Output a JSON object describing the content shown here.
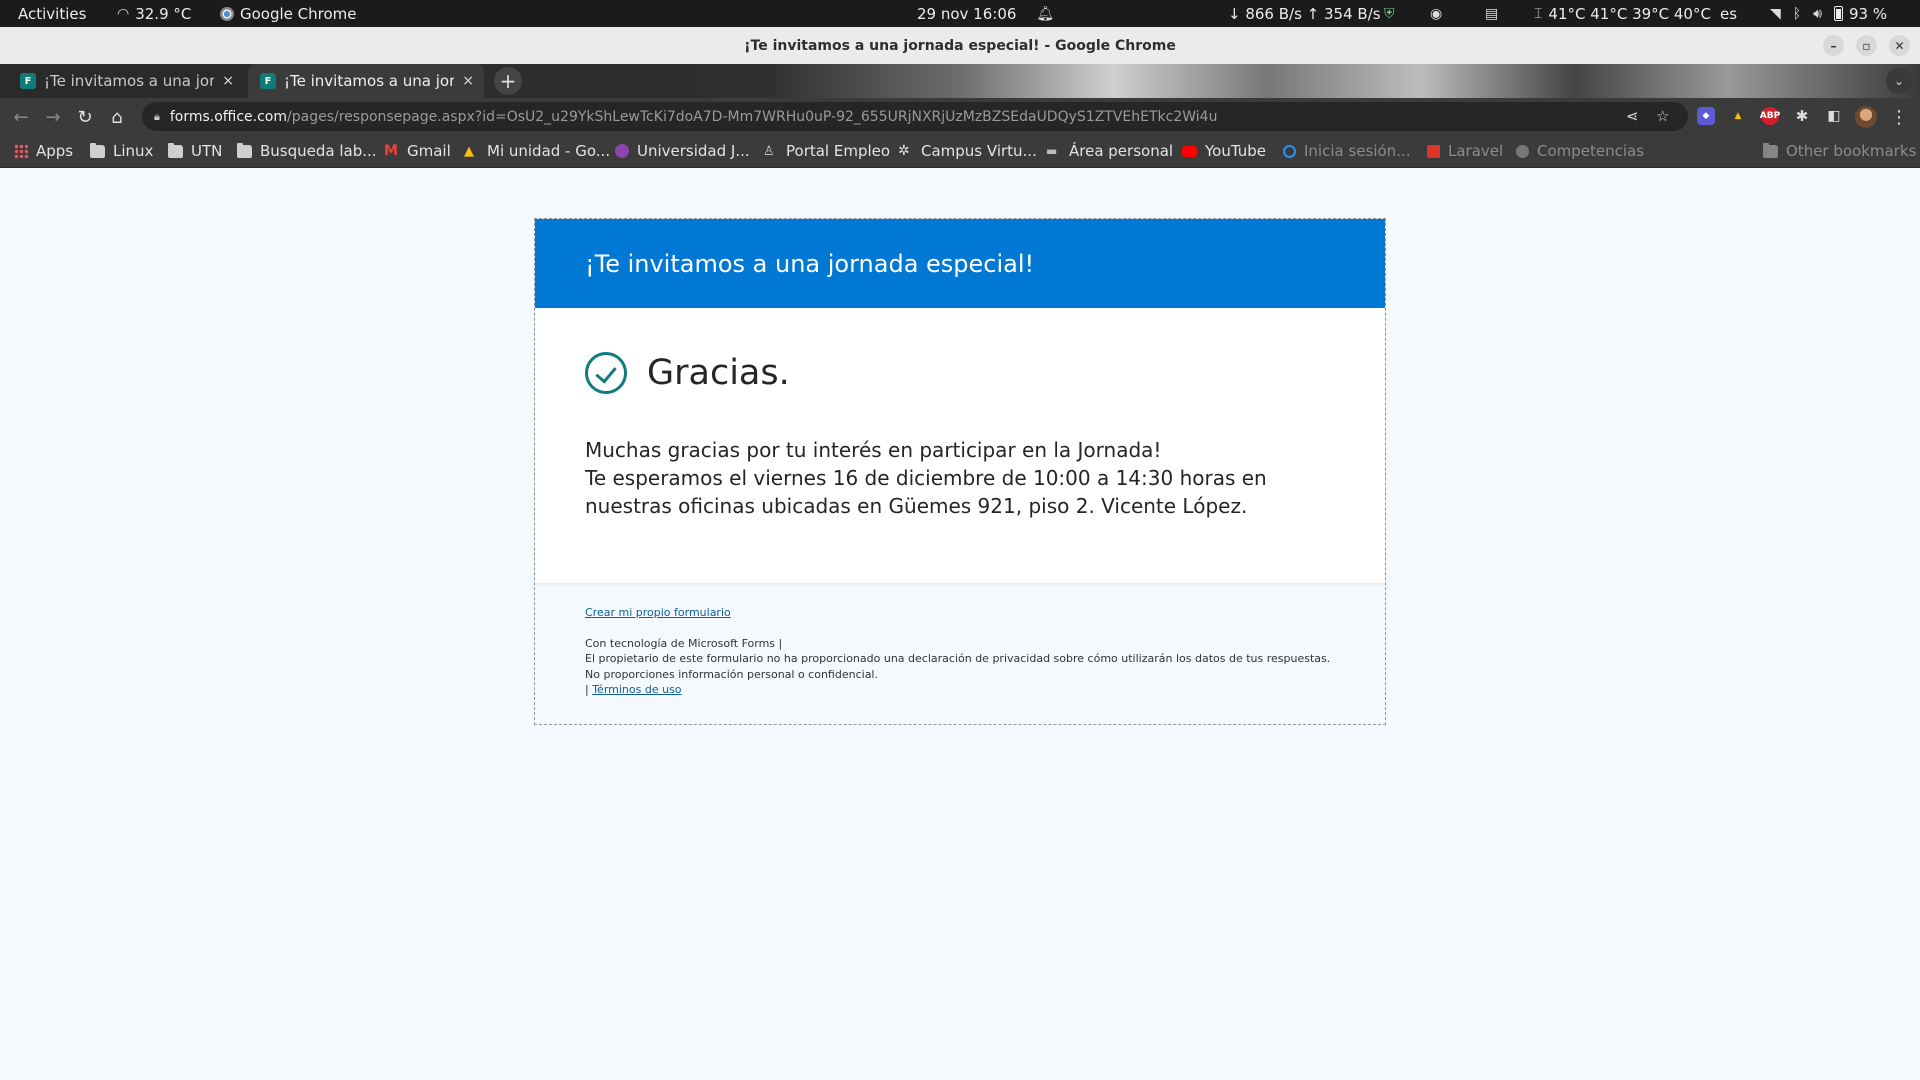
{
  "topbar": {
    "activities": "Activities",
    "temperature": "32.9 °C",
    "app_name": "Google Chrome",
    "datetime": "29 nov  16:06",
    "network": "↓ 866 B/s  ↑ 354 B/s",
    "cpu_temps": "41°C 41°C 39°C 40°C",
    "language": "es",
    "battery": "93 %"
  },
  "window": {
    "title": "¡Te invitamos a una jornada especial! - Google Chrome"
  },
  "tabs": [
    {
      "label": "¡Te invitamos a una jornada especial!",
      "close": "×"
    },
    {
      "label": "¡Te invitamos a una jornada especial!",
      "close": "×"
    }
  ],
  "new_tab": "+",
  "omnibox": {
    "host": "forms.office.com",
    "path": "/pages/responsepage.aspx?id=OsU2_u29YkShLewTcKi7doA7D-Mm7WRHu0uP-92_655URjNXRjUzMzBZSEdaUDQyS1ZTVEhETkc2Wi4u"
  },
  "bookmarks": [
    {
      "label": "Apps",
      "icon": "apps-grid-icon"
    },
    {
      "label": "Linux",
      "icon": "folder-icon"
    },
    {
      "label": "UTN",
      "icon": "folder-icon"
    },
    {
      "label": "Busqueda lab...",
      "icon": "folder-icon"
    },
    {
      "label": "Gmail",
      "icon": "gmail-icon"
    },
    {
      "label": "Mi unidad - Go...",
      "icon": "google-drive-icon"
    },
    {
      "label": "Universidad J...",
      "icon": "university-icon"
    },
    {
      "label": "Portal Empleo",
      "icon": "portal-empleo-icon"
    },
    {
      "label": "Campus Virtu...",
      "icon": "campus-icon"
    },
    {
      "label": "Área personal",
      "icon": "area-personal-icon"
    },
    {
      "label": "YouTube",
      "icon": "youtube-icon"
    },
    {
      "label": "Inicia sesión...",
      "icon": "login-icon"
    },
    {
      "label": "Laravel",
      "icon": "laravel-icon"
    },
    {
      "label": "Competencias",
      "icon": "globe-icon"
    }
  ],
  "other_bookmarks": "Other bookmarks",
  "form": {
    "header_title": "¡Te invitamos a una jornada especial!",
    "thanks": "Gracias.",
    "message_lines": [
      "Muchas gracias por tu interés en participar en la Jornada!",
      "Te esperamos el viernes 16 de diciembre de 10:00 a 14:30 horas en nuestras oficinas ubicadas en Güemes 921, piso 2. Vicente López."
    ],
    "create_link": "Crear mi propio formulario",
    "powered_by": "Con tecnología de Microsoft Forms |",
    "privacy": "El propietario de este formulario no ha proporcionado una declaración de privacidad sobre cómo utilizarán los datos de tus respuestas. No proporciones información personal o confidencial.",
    "terms_prefix": "| ",
    "terms_link": "Términos de uso"
  },
  "colors": {
    "header_blue": "#0078d4",
    "check_teal": "#137a7f",
    "page_bg": "#f3f9fd"
  }
}
